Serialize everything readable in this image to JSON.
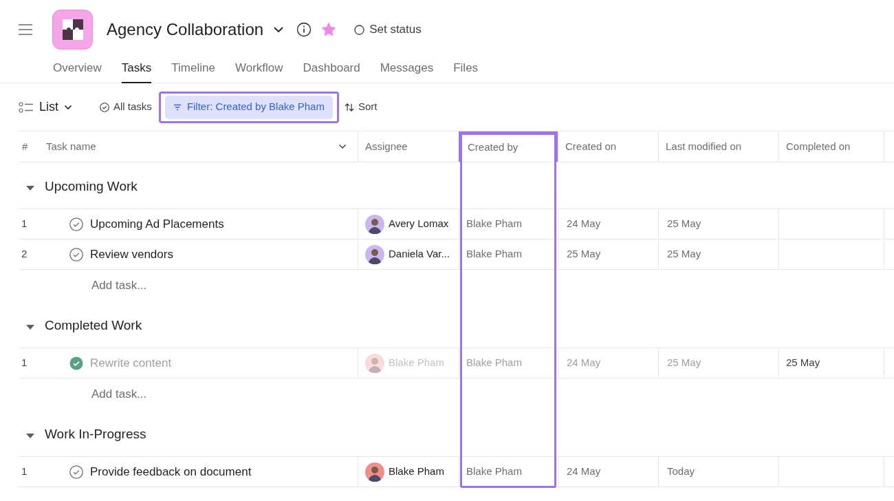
{
  "header": {
    "title": "Agency Collaboration",
    "starred": true,
    "status": "Set status"
  },
  "tabs": [
    {
      "label": "Overview",
      "selected": false
    },
    {
      "label": "Tasks",
      "selected": true
    },
    {
      "label": "Timeline",
      "selected": false
    },
    {
      "label": "Workflow",
      "selected": false
    },
    {
      "label": "Dashboard",
      "selected": false
    },
    {
      "label": "Messages",
      "selected": false
    },
    {
      "label": "Files",
      "selected": false
    }
  ],
  "toolbar": {
    "view": "List",
    "completion": "All tasks",
    "filter": {
      "label": "Filter: Created by Blake Pham",
      "highlighted": true
    },
    "sort": "Sort"
  },
  "table": {
    "columns": [
      {
        "label": "#",
        "highlighted": false
      },
      {
        "label": "Task name",
        "highlighted": false
      },
      {
        "label": "Assignee",
        "highlighted": false
      },
      {
        "label": "Created by",
        "highlighted": true
      },
      {
        "label": "Created on",
        "highlighted": false
      },
      {
        "label": "Last modified on",
        "highlighted": false
      },
      {
        "label": "Completed on",
        "highlighted": false
      }
    ],
    "sections": [
      {
        "title": "Upcoming Work",
        "expanded": true,
        "add_task": "Add task...",
        "tasks": [
          {
            "number": "1",
            "name": "Upcoming Ad Placements",
            "completed": false,
            "assignee": "Avery Lomax",
            "color": "#c9b8ef",
            "created_by": "Blake Pham",
            "created_on": "24 May",
            "modified_on": "25 May"
          },
          {
            "number": "2",
            "name": "Review vendors",
            "completed": false,
            "assignee": "Daniela Var...",
            "color": "#c9b8ef",
            "created_by": "Blake Pham",
            "created_on": "25 May",
            "modified_on": "25 May"
          }
        ]
      },
      {
        "title": "Completed Work",
        "expanded": true,
        "add_task": "Add task...",
        "tasks": [
          {
            "number": "1",
            "name": "Rewrite content",
            "completed": true,
            "assignee": "Blake Pham",
            "color": "#f9dcdb",
            "created_by": "Blake Pham",
            "created_on": "24 May",
            "modified_on": "25 May",
            "completed_on": "25 May"
          }
        ]
      },
      {
        "title": "Work In-Progress",
        "expanded": true,
        "tasks": [
          {
            "number": "1",
            "name": "Provide feedback on document",
            "completed": false,
            "assignee": "Blake Pham",
            "color": "#f08f8a",
            "created_by": "Blake Pham",
            "created_on": "24 May",
            "modified_on": "Today"
          }
        ]
      }
    ]
  }
}
